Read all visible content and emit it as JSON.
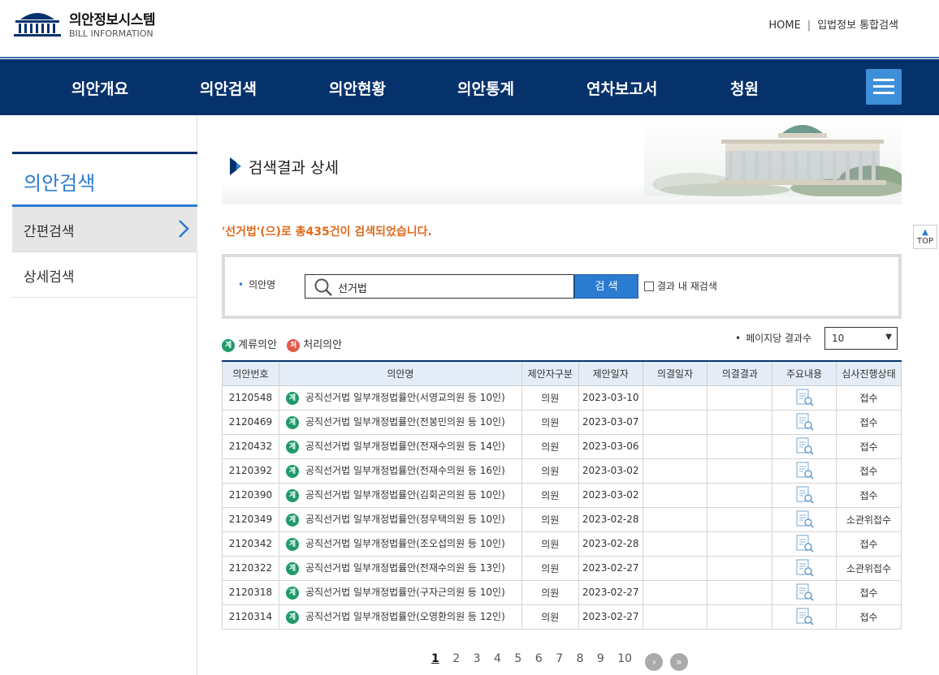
{
  "site": {
    "title": "의안정보시스템",
    "subtitle": "BILL INFORMATION"
  },
  "top_links": [
    "HOME",
    "입법정보 통합검색"
  ],
  "gnb": [
    "의안개요",
    "의안검색",
    "의안현황",
    "의안통계",
    "연차보고서",
    "청원"
  ],
  "lnb": {
    "title": "의안검색",
    "items": [
      "간편검색",
      "상세검색"
    ]
  },
  "page_title": "검색결과 상세",
  "result_msg": "'선거법'(으)로 총435건이 검색되었습니다.",
  "search": {
    "label": "의안명",
    "value": "선거법",
    "button": "검 색",
    "refine_label": "결과 내 재검색"
  },
  "legend": {
    "pending_badge": "계",
    "pending": "계류의안",
    "done_badge": "처",
    "done": "처리의안"
  },
  "paging": {
    "label": "페이지당 결과수",
    "value": "10"
  },
  "table": {
    "headers": [
      "의안번호",
      "의안명",
      "제안자구분",
      "제안일자",
      "의결일자",
      "의결결과",
      "주요내용",
      "심사진행상태"
    ],
    "rows": [
      {
        "no": "2120548",
        "badge": "계",
        "name": "공직선거법 일부개정법률안(서영교의원 등 10인)",
        "proposer": "의원",
        "date": "2023-03-10",
        "res_date": "",
        "result": "",
        "status": "접수"
      },
      {
        "no": "2120469",
        "badge": "계",
        "name": "공직선거법 일부개정법률안(전봉민의원 등 10인)",
        "proposer": "의원",
        "date": "2023-03-07",
        "res_date": "",
        "result": "",
        "status": "접수"
      },
      {
        "no": "2120432",
        "badge": "계",
        "name": "공직선거법 일부개정법률안(전재수의원 등 14인)",
        "proposer": "의원",
        "date": "2023-03-06",
        "res_date": "",
        "result": "",
        "status": "접수"
      },
      {
        "no": "2120392",
        "badge": "계",
        "name": "공직선거법 일부개정법률안(전재수의원 등 16인)",
        "proposer": "의원",
        "date": "2023-03-02",
        "res_date": "",
        "result": "",
        "status": "접수"
      },
      {
        "no": "2120390",
        "badge": "계",
        "name": "공직선거법 일부개정법률안(김회곤의원 등 10인)",
        "proposer": "의원",
        "date": "2023-03-02",
        "res_date": "",
        "result": "",
        "status": "접수"
      },
      {
        "no": "2120349",
        "badge": "계",
        "name": "공직선거법 일부개정법률안(정우택의원 등 10인)",
        "proposer": "의원",
        "date": "2023-02-28",
        "res_date": "",
        "result": "",
        "status": "소관위접수"
      },
      {
        "no": "2120342",
        "badge": "계",
        "name": "공직선거법 일부개정법률안(조오섭의원 등 10인)",
        "proposer": "의원",
        "date": "2023-02-28",
        "res_date": "",
        "result": "",
        "status": "접수"
      },
      {
        "no": "2120322",
        "badge": "계",
        "name": "공직선거법 일부개정법률안(전재수의원 등 13인)",
        "proposer": "의원",
        "date": "2023-02-27",
        "res_date": "",
        "result": "",
        "status": "소관위접수"
      },
      {
        "no": "2120318",
        "badge": "계",
        "name": "공직선거법 일부개정법률안(구자근의원 등 10인)",
        "proposer": "의원",
        "date": "2023-02-27",
        "res_date": "",
        "result": "",
        "status": "접수"
      },
      {
        "no": "2120314",
        "badge": "계",
        "name": "공직선거법 일부개정법률안(오영환의원 등 12인)",
        "proposer": "의원",
        "date": "2023-02-27",
        "res_date": "",
        "result": "",
        "status": "접수"
      }
    ]
  },
  "pager": {
    "pages": [
      "1",
      "2",
      "3",
      "4",
      "5",
      "6",
      "7",
      "8",
      "9",
      "10"
    ],
    "current": "1",
    "next_label": "›",
    "last_label": "»"
  },
  "top_button": {
    "arrow": "▲",
    "label": "TOP"
  },
  "colors": {
    "nav_bg": "#06326c",
    "accent": "#2b7bd0",
    "result": "#e06a1e"
  }
}
